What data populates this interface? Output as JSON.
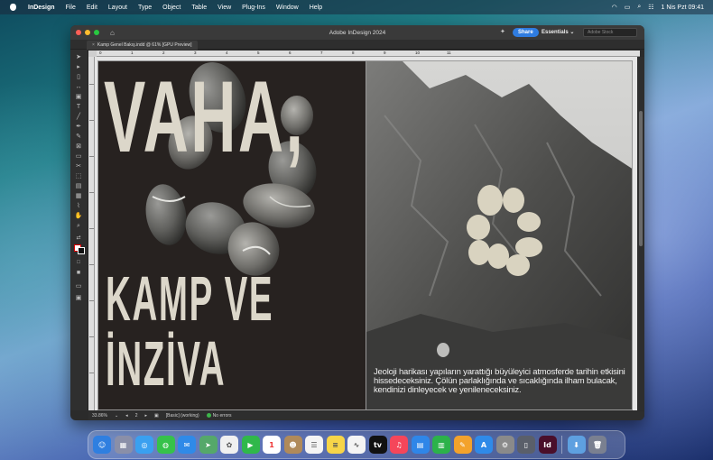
{
  "menubar": {
    "app_name": "InDesign",
    "items": [
      "File",
      "Edit",
      "Layout",
      "Type",
      "Object",
      "Table",
      "View",
      "Plug-Ins",
      "Window",
      "Help"
    ],
    "datetime": "1 Nis Pzt  09:41"
  },
  "window": {
    "title": "Adobe InDesign 2024",
    "share_label": "Share",
    "workspace_label": "Essentials",
    "search_placeholder": "Adobe Stock",
    "doc_tab": "Kamp Genel Bakış.indd @ 61% [GPU Preview]"
  },
  "ruler_labels": [
    "0",
    "1",
    "2",
    "3",
    "4",
    "5",
    "6",
    "7",
    "8",
    "9",
    "10",
    "11"
  ],
  "document": {
    "headline_1": "VAHA,",
    "headline_2": "KAMP VE",
    "headline_3": "İNZİVA",
    "caption": "Jeoloji harikası yapıların yarattığı büyüleyici atmosferde tarihin etkisini hissedeceksiniz. Çölün parlaklığında ve sıcaklığında ilham bulacak, kendinizi dinleyecek ve yenileneceksiniz."
  },
  "statusbar": {
    "zoom": "33.86%",
    "page": "2",
    "style": "[Basic] (working)",
    "preflight": "No errors"
  },
  "colors": {
    "page_dark": "#272220",
    "headline": "#dcd7ca",
    "share_blue": "#2f7ce0",
    "window_bg": "#2b2b2b"
  },
  "dock": [
    {
      "name": "finder-icon",
      "glyph": "☺",
      "bg": "#2f7fe0"
    },
    {
      "name": "launchpad-icon",
      "glyph": "▦",
      "bg": "#8a8fa8"
    },
    {
      "name": "safari-icon",
      "glyph": "◎",
      "bg": "#3aa0f0"
    },
    {
      "name": "messages-icon",
      "glyph": "◍",
      "bg": "#36c24a"
    },
    {
      "name": "mail-icon",
      "glyph": "✉",
      "bg": "#2f8ae8"
    },
    {
      "name": "maps-icon",
      "glyph": "➤",
      "bg": "#55a86a"
    },
    {
      "name": "photos-icon",
      "glyph": "✿",
      "bg": "#f0f0f0"
    },
    {
      "name": "facetime-icon",
      "glyph": "▶",
      "bg": "#30b84a"
    },
    {
      "name": "calendar-icon",
      "glyph": "1",
      "bg": "#ffffff"
    },
    {
      "name": "contacts-icon",
      "glyph": "☻",
      "bg": "#b08a5a"
    },
    {
      "name": "reminders-icon",
      "glyph": "☰",
      "bg": "#f4f4f4"
    },
    {
      "name": "notes-icon",
      "glyph": "≡",
      "bg": "#f7d548"
    },
    {
      "name": "freeform-icon",
      "glyph": "∿",
      "bg": "#f4f4f4"
    },
    {
      "name": "tv-icon",
      "glyph": "tv",
      "bg": "#111111"
    },
    {
      "name": "music-icon",
      "glyph": "♫",
      "bg": "#f5465a"
    },
    {
      "name": "keynote-icon",
      "glyph": "▤",
      "bg": "#2f86e8"
    },
    {
      "name": "numbers-icon",
      "glyph": "▥",
      "bg": "#2cb24a"
    },
    {
      "name": "pages-icon",
      "glyph": "✎",
      "bg": "#f3a22c"
    },
    {
      "name": "app-store-icon",
      "glyph": "A",
      "bg": "#2f8ae8"
    },
    {
      "name": "system-settings-icon",
      "glyph": "⚙",
      "bg": "#8a8a8a"
    },
    {
      "name": "iphone-mirroring-icon",
      "glyph": "▯",
      "bg": "#5a5f6a"
    },
    {
      "name": "indesign-icon",
      "glyph": "Id",
      "bg": "#4a0f2a"
    },
    {
      "name": "downloads-icon",
      "glyph": "⬇",
      "bg": "#5ea0e0"
    },
    {
      "name": "trash-icon",
      "glyph": "🗑",
      "bg": "#7a8090"
    }
  ]
}
